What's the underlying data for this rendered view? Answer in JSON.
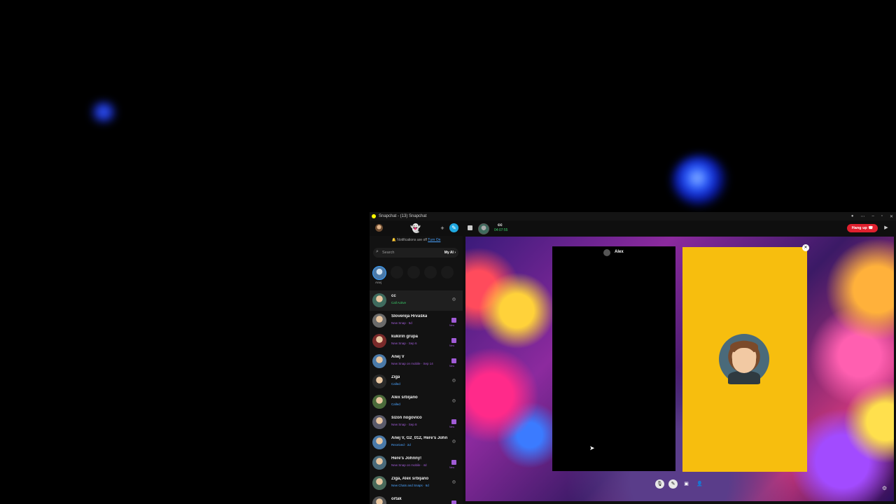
{
  "window": {
    "title": "Snapchat - (13) Snapchat"
  },
  "toolbar": {
    "callee_name": "cc",
    "call_time": "04:07:55",
    "hangup_label": "Hang up"
  },
  "sidebar": {
    "notice": "Notifications are off",
    "notice_action": "Turn On",
    "search_placeholder": "Search",
    "my_ai": "My AI",
    "story_label": "Anej",
    "chats": [
      {
        "name": "cc",
        "status": "Call Active",
        "status_color": "#3ad16b"
      },
      {
        "name": "Slovenija Hrvaška",
        "status": "New Snap · 5d",
        "status_color": "#a05bd6"
      },
      {
        "name": "kukirin grupa",
        "status": "New Snap · Sep 6",
        "status_color": "#a05bd6"
      },
      {
        "name": "Anej V",
        "status": "New Snap on mobile · Sep 14",
        "status_color": "#a05bd6"
      },
      {
        "name": "Žiga",
        "status": "Called",
        "status_color": "#4aa3ff"
      },
      {
        "name": "Alex srbijano",
        "status": "Called",
        "status_color": "#4aa3ff"
      },
      {
        "name": "šizon nogovico",
        "status": "New Snap · Sep 8",
        "status_color": "#a05bd6"
      },
      {
        "name": "Anej V, G2_012, Here's Johnny!",
        "status": "Received · 2d",
        "status_color": "#4aa3ff"
      },
      {
        "name": "Here's Johnny!",
        "status": "New Snap on mobile · 4d",
        "status_color": "#a05bd6"
      },
      {
        "name": "Žiga, Alex srbijano",
        "status": "New Chats and Snaps · 6d",
        "status_color": "#4aa3ff"
      },
      {
        "name": "ortak",
        "status": "",
        "status_color": "#a05bd6"
      }
    ],
    "new_label": "New"
  },
  "call": {
    "participant_name": "Alex"
  },
  "colors": {
    "accent": "#fffc00",
    "hangup": "#e0202e",
    "tile_yellow": "#f7be0e"
  }
}
